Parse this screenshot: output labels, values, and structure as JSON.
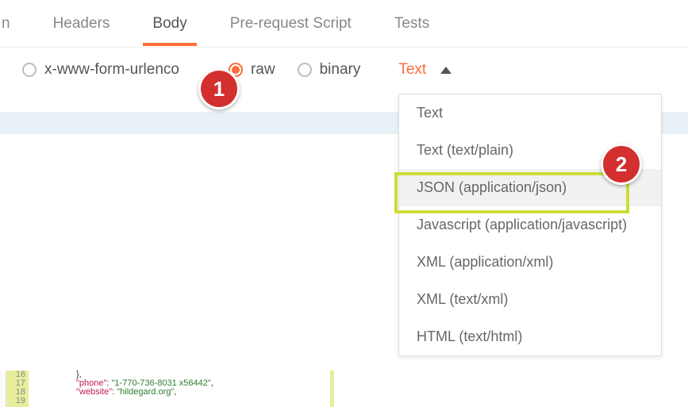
{
  "tabs": {
    "t0": "n",
    "t1": "Headers",
    "t2": "Body",
    "t3": "Pre-request Script",
    "t4": "Tests"
  },
  "body_types": {
    "urlencoded": "x-www-form-urlenco",
    "raw": "raw",
    "binary": "binary"
  },
  "format_dropdown": {
    "trigger": "Text",
    "items": {
      "i0": "Text",
      "i1": "Text (text/plain)",
      "i2": "JSON (application/json)",
      "i3": "Javascript (application/javascript)",
      "i4": "XML (application/xml)",
      "i5": "XML (text/xml)",
      "i6": "HTML (text/html)"
    }
  },
  "callouts": {
    "c1": "1",
    "c2": "2"
  },
  "code": {
    "line_nums": {
      "l16": "16",
      "l17": "17",
      "l18": "18",
      "l19": "19"
    },
    "l16_text": "},",
    "l17_key": "\"phone\"",
    "l17_val": "\"1-770-736-8031 x56442\"",
    "l18_key": "\"website\"",
    "l18_val": "\"hildegard.org\""
  }
}
